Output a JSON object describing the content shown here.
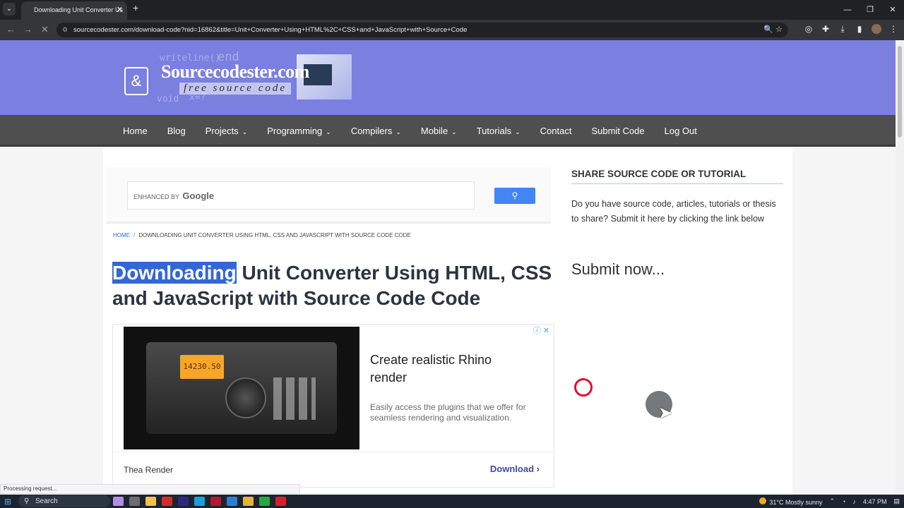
{
  "browser": {
    "tab_title": "Downloading Unit Converter Us",
    "tab_close": "✕",
    "new_tab": "+",
    "url": "sourcecodester.com/download-code?nid=16862&title=Unit+Converter+Using+HTML%2C+CSS+and+JavaScript+with+Source+Code"
  },
  "site": {
    "logo_title": "Sourcecodester.com",
    "logo_tagline": "free source code",
    "logo_bg_words": [
      "writeline()",
      "end",
      "void",
      "x=?"
    ],
    "nav": [
      {
        "label": "Home",
        "caret": false
      },
      {
        "label": "Blog",
        "caret": false
      },
      {
        "label": "Projects",
        "caret": true
      },
      {
        "label": "Programming",
        "caret": true
      },
      {
        "label": "Compilers",
        "caret": true
      },
      {
        "label": "Mobile",
        "caret": true
      },
      {
        "label": "Tutorials",
        "caret": true
      },
      {
        "label": "Contact",
        "caret": false
      },
      {
        "label": "Submit Code",
        "caret": false
      },
      {
        "label": "Log Out",
        "caret": false
      }
    ]
  },
  "search": {
    "enhanced_by": "ENHANCED BY",
    "google": "Google"
  },
  "breadcrumb": {
    "home": "HOME",
    "separator": "/",
    "current": "DOWNLOADING UNIT CONVERTER USING HTML, CSS AND JAVASCRIPT WITH SOURCE CODE CODE"
  },
  "heading": {
    "highlighted": "Downloading",
    "rest": " Unit Converter Using HTML, CSS and JavaScript with Source Code Code"
  },
  "ad": {
    "lcd": "14230.50",
    "title": "Create realistic Rhino render",
    "description": "Easily access the plugins that we offer for seamless rendering and visualization.",
    "advertiser": "Thea Render",
    "cta": "Download"
  },
  "sidebar": {
    "title": "SHARE SOURCE CODE OR TUTORIAL",
    "text": "Do you have source code, articles, tutorials or thesis to share? Submit it here by clicking the link below",
    "submit": "Submit now..."
  },
  "status": {
    "text": "Processing request..."
  },
  "taskbar": {
    "search": "Search",
    "weather": "31°C  Mostly sunny",
    "time": "4:47 PM"
  },
  "colors": {
    "header": "#7b7fe0",
    "nav": "#4f4f4f",
    "highlight": "#3367d6",
    "search_button": "#4285f4",
    "click_ring": "#e0102f"
  }
}
